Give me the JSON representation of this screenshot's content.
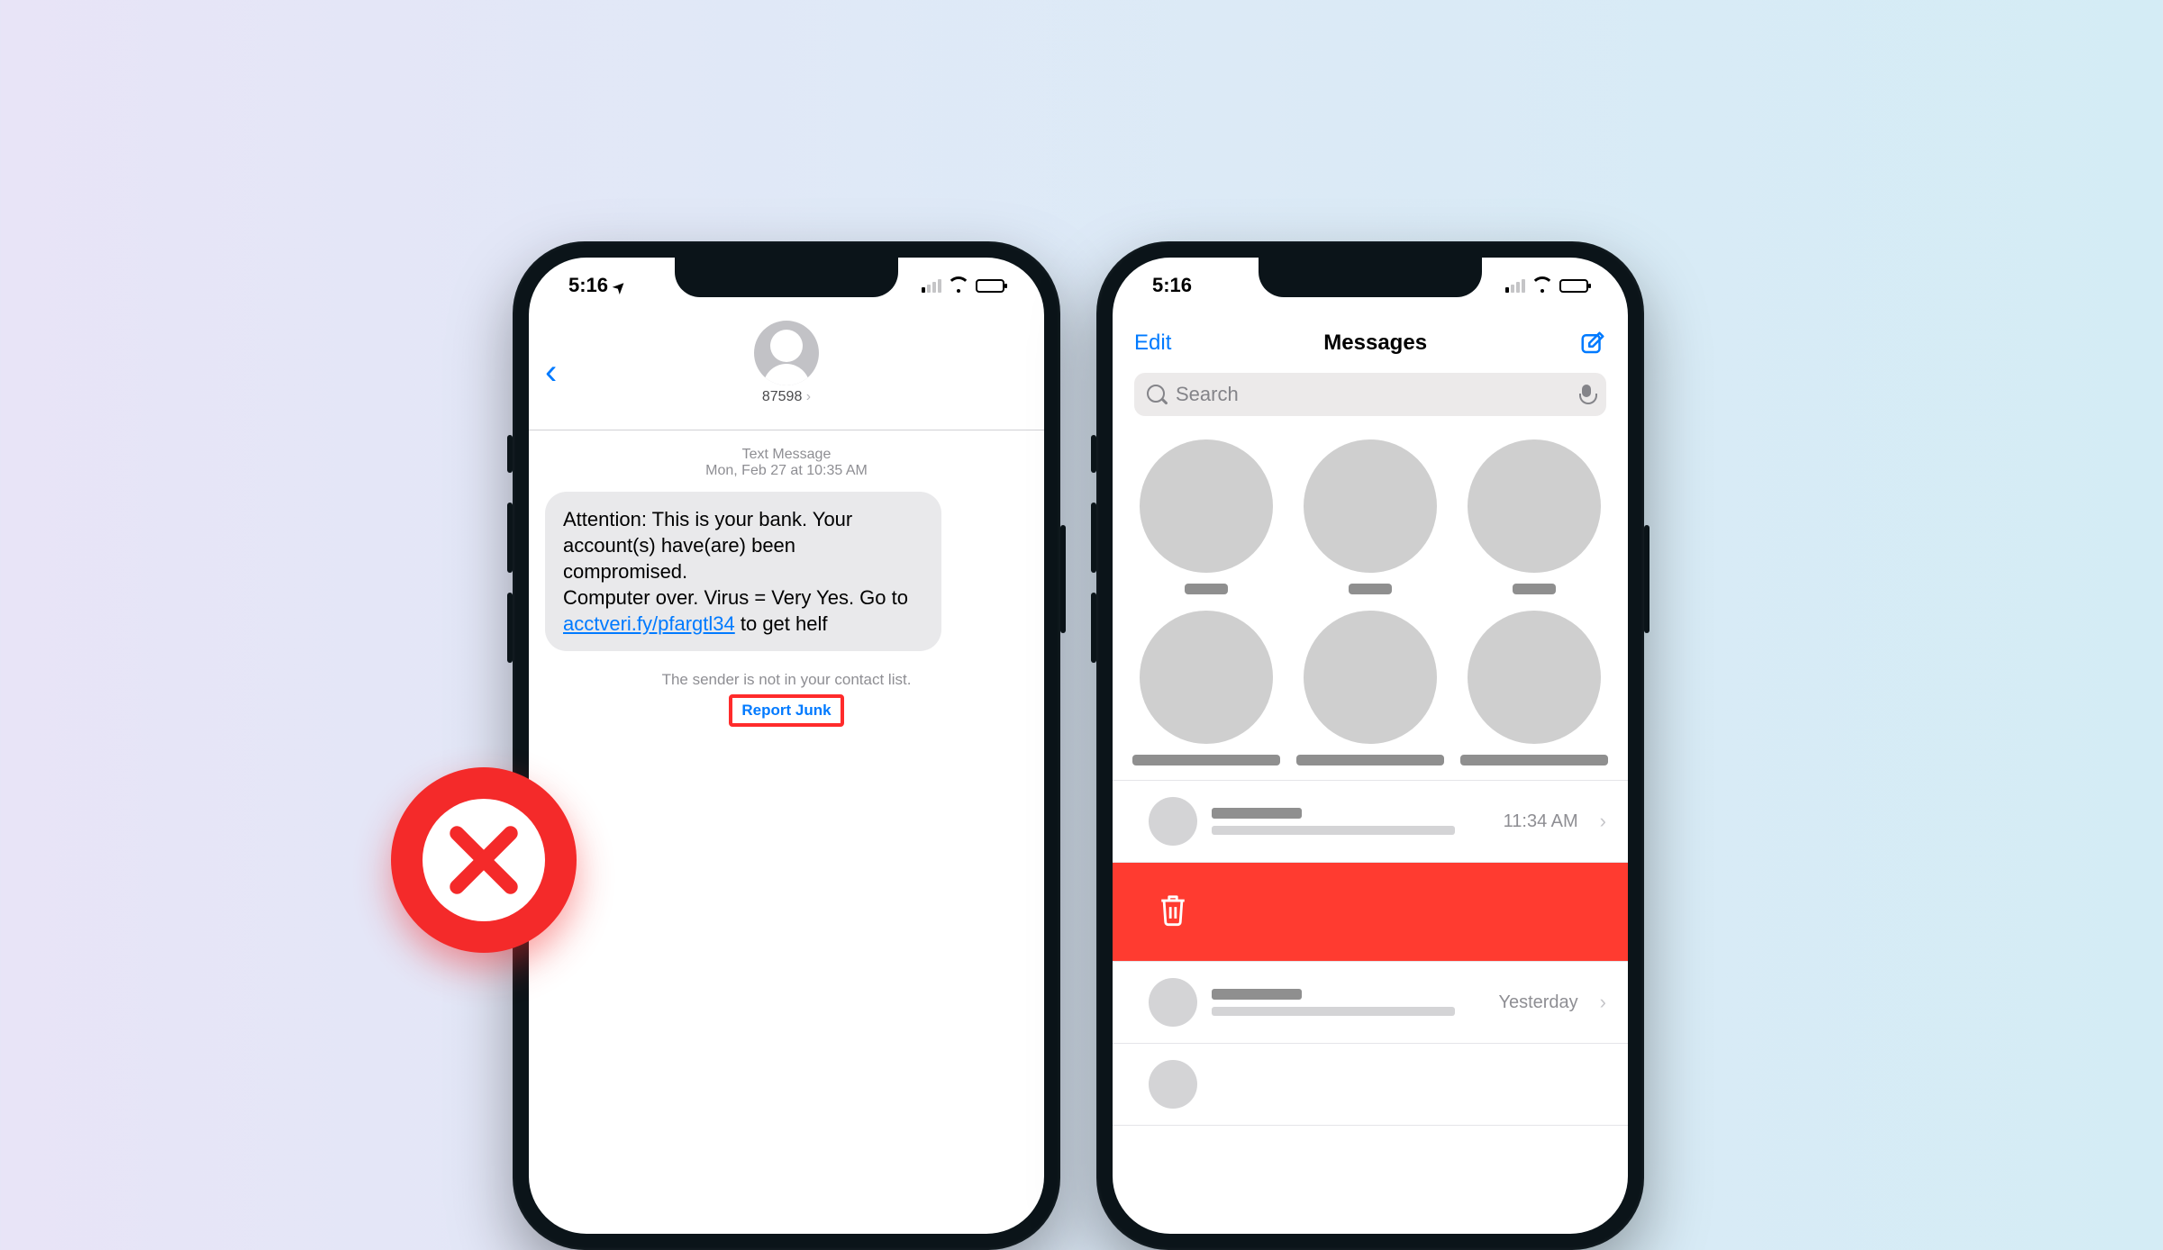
{
  "badge_color": "#f42a2a",
  "phone_left": {
    "status": {
      "time": "5:16"
    },
    "contact_name": "87598",
    "message_type_label": "Text Message",
    "timestamp": "Mon, Feb 27 at 10:35 AM",
    "message_body_pre": "Attention: This is your bank. Your account(s) have(are) been compromised.\nComputer over. Virus = Very Yes. Go to ",
    "message_link": "acctveri.fy/pfargtl34",
    "message_body_post": " to get helf",
    "unknown_sender_note": "The sender is not in your contact list.",
    "report_junk_label": "Report Junk"
  },
  "phone_right": {
    "status": {
      "time": "5:16"
    },
    "edit_label": "Edit",
    "title": "Messages",
    "search_placeholder": "Search",
    "rows": [
      {
        "time": "11:34 AM"
      },
      {
        "time": "Yesterday"
      }
    ]
  }
}
